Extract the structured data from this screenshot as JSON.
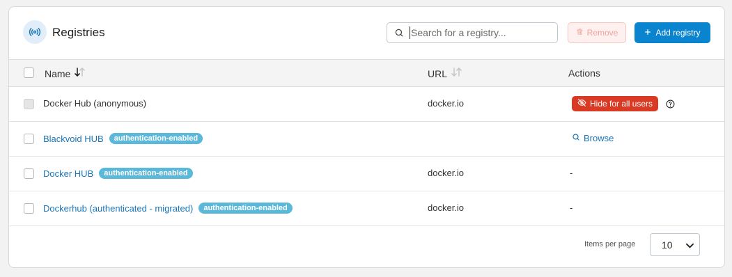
{
  "header": {
    "title": "Registries",
    "search_placeholder": "Search for a registry...",
    "remove_label": "Remove",
    "add_label": "Add registry"
  },
  "columns": {
    "name": "Name",
    "url": "URL",
    "actions": "Actions"
  },
  "rows": [
    {
      "name": "Docker Hub (anonymous)",
      "badge": "",
      "url": "docker.io",
      "action": "Hide for all users"
    },
    {
      "name": "Blackvoid HUB",
      "badge": "authentication-enabled",
      "url": "",
      "action": "Browse"
    },
    {
      "name": "Docker HUB",
      "badge": "authentication-enabled",
      "url": "docker.io",
      "action": "-"
    },
    {
      "name": "Dockerhub (authenticated - migrated)",
      "badge": "authentication-enabled",
      "url": "docker.io",
      "action": "-"
    }
  ],
  "footer": {
    "items_per_page_label": "Items per page",
    "items_per_page_value": "10"
  },
  "colors": {
    "primary": "#0b84d0",
    "danger": "#d93a24",
    "badge": "#5bb8d8",
    "link": "#1a75b8"
  }
}
